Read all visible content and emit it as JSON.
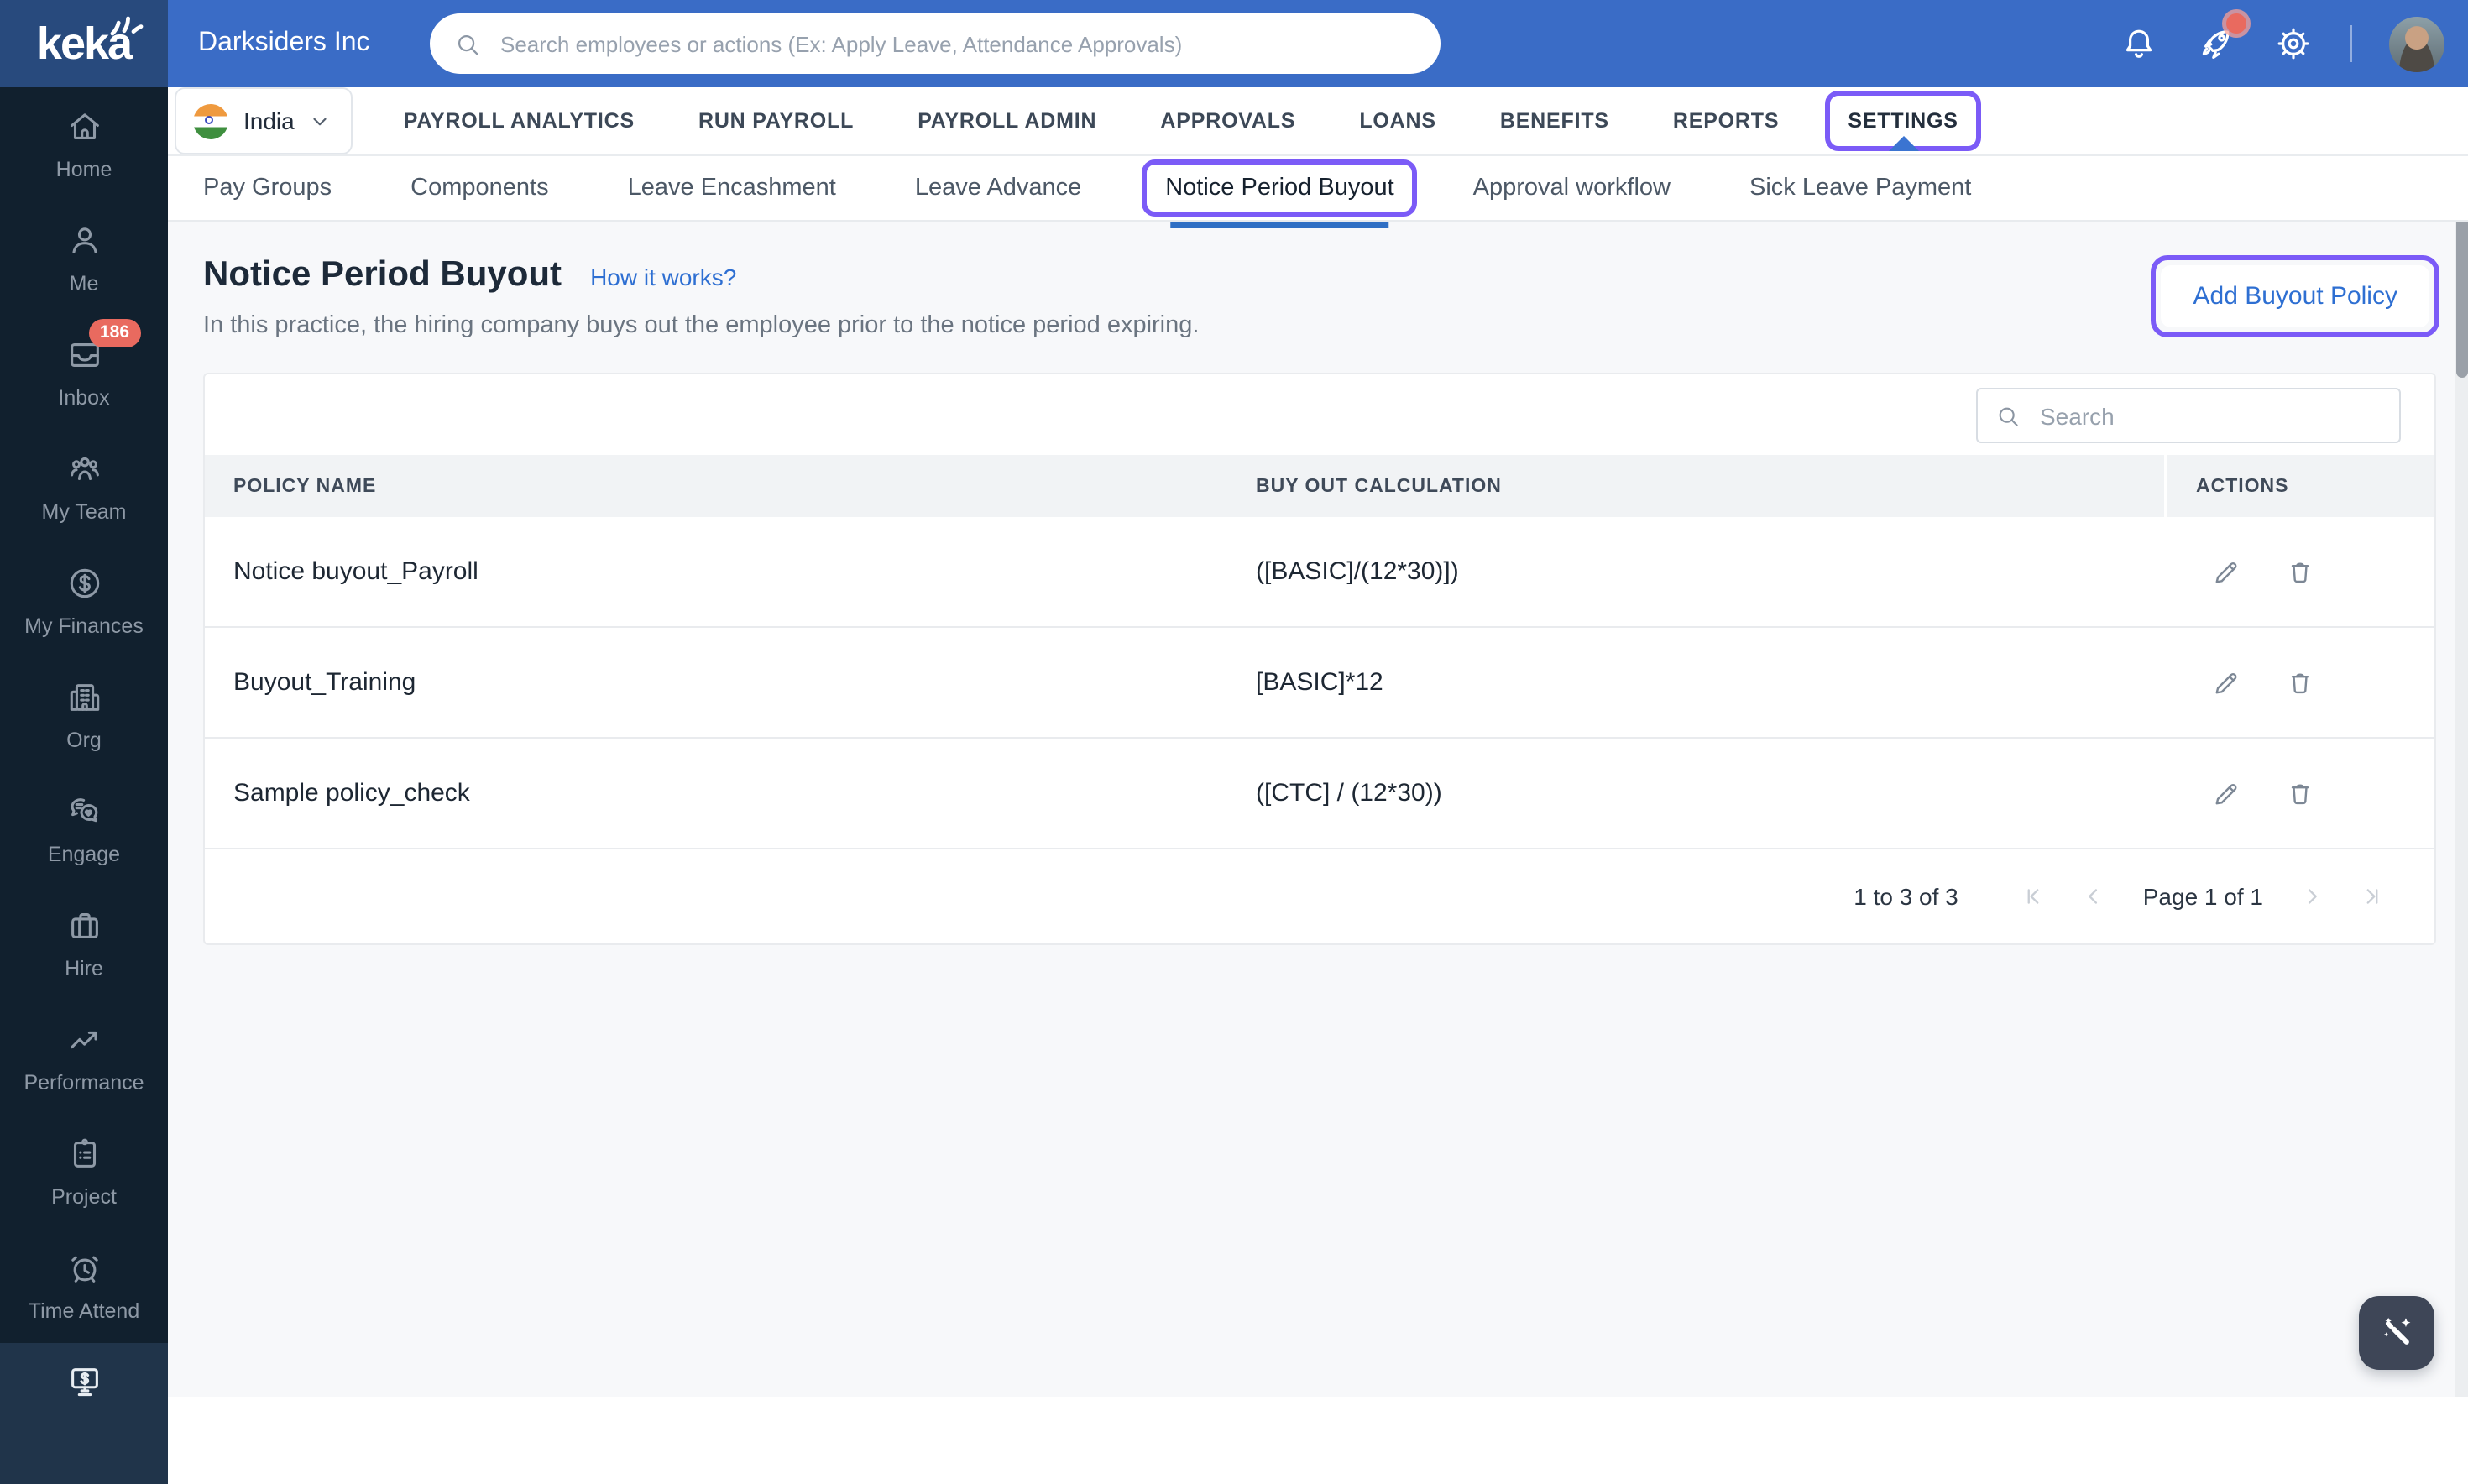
{
  "topbar": {
    "logo_text": "keka",
    "company_name": "Darksiders Inc",
    "search_placeholder": "Search employees or actions (Ex: Apply Leave, Attendance Approvals)"
  },
  "sidebar": {
    "items": [
      {
        "label": "Home",
        "icon": "home-icon"
      },
      {
        "label": "Me",
        "icon": "user-icon"
      },
      {
        "label": "Inbox",
        "icon": "inbox-icon",
        "badge": "186"
      },
      {
        "label": "My Team",
        "icon": "team-icon"
      },
      {
        "label": "My Finances",
        "icon": "dollar-circle-icon"
      },
      {
        "label": "Org",
        "icon": "building-icon"
      },
      {
        "label": "Engage",
        "icon": "chat-heart-icon"
      },
      {
        "label": "Hire",
        "icon": "briefcase-icon"
      },
      {
        "label": "Performance",
        "icon": "trend-up-icon"
      },
      {
        "label": "Project",
        "icon": "clipboard-icon"
      },
      {
        "label": "Time Attend",
        "icon": "alarm-clock-icon"
      },
      {
        "label": "",
        "icon": "payroll-monitor-icon",
        "active": true
      }
    ]
  },
  "nav": {
    "region": {
      "label": "India",
      "icon": "india-flag-icon"
    },
    "tabs": [
      {
        "label": "PAYROLL ANALYTICS"
      },
      {
        "label": "RUN PAYROLL"
      },
      {
        "label": "PAYROLL ADMIN"
      },
      {
        "label": "APPROVALS"
      },
      {
        "label": "LOANS"
      },
      {
        "label": "BENEFITS"
      },
      {
        "label": "REPORTS"
      },
      {
        "label": "SETTINGS",
        "active": true
      }
    ]
  },
  "subnav": {
    "tabs": [
      {
        "label": "Pay Groups"
      },
      {
        "label": "Components"
      },
      {
        "label": "Leave Encashment"
      },
      {
        "label": "Leave Advance"
      },
      {
        "label": "Notice Period Buyout",
        "active": true
      },
      {
        "label": "Approval workflow"
      },
      {
        "label": "Sick Leave Payment"
      }
    ]
  },
  "page": {
    "title": "Notice Period Buyout",
    "help_link": "How it works?",
    "description": "In this practice, the hiring company buys out the employee prior to the notice period expiring.",
    "add_button_label": "Add Buyout Policy"
  },
  "table": {
    "search_placeholder": "Search",
    "columns": [
      "POLICY NAME",
      "BUY OUT CALCULATION",
      "ACTIONS"
    ],
    "rows": [
      {
        "policy_name": "Notice buyout_Payroll",
        "calculation": "([BASIC]/(12*30)])"
      },
      {
        "policy_name": "Buyout_Training",
        "calculation": "[BASIC]*12"
      },
      {
        "policy_name": "Sample policy_check",
        "calculation": "([CTC] / (12*30))"
      }
    ],
    "pagination": {
      "range": "1 to 3 of 3",
      "page": "Page 1 of 1"
    }
  },
  "colors": {
    "topbar_blue": "#3a6cc6",
    "logo_navy": "#284a7d",
    "sidebar_navy": "#11202e",
    "annotation_purple": "#7b5bf7",
    "link_blue": "#2e6fd2",
    "active_underline_blue": "#2f6fc4",
    "badge_red": "#e96a5f"
  }
}
